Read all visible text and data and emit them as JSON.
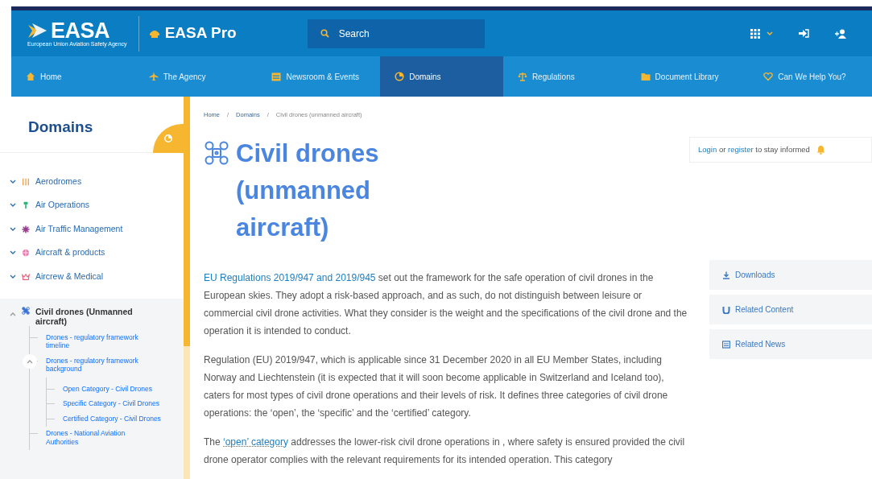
{
  "header": {
    "logo": "EASA",
    "logo_subtitle": "European Union Aviation Safety Agency",
    "product": "EASA Pro",
    "search": {
      "placeholder": "Search"
    }
  },
  "nav": [
    {
      "label": "Home",
      "selected": false
    },
    {
      "label": "The Agency",
      "selected": false
    },
    {
      "label": "Newsroom & Events",
      "selected": false
    },
    {
      "label": "Domains",
      "selected": true
    },
    {
      "label": "Regulations",
      "selected": false
    },
    {
      "label": "Document Library",
      "selected": false
    },
    {
      "label": "Can We Help You?",
      "selected": false
    }
  ],
  "sidebar": {
    "title": "Domains",
    "items": [
      {
        "label": "Aerodromes",
        "expanded": false,
        "selected": false,
        "color": "#f0a452"
      },
      {
        "label": "Air Operations",
        "expanded": false,
        "selected": false,
        "color": "#2fb67c"
      },
      {
        "label": "Air Traffic Management",
        "expanded": false,
        "selected": false,
        "color": "#9a3c8e"
      },
      {
        "label": "Aircraft & products",
        "expanded": false,
        "selected": false,
        "color": "#e77fb3"
      },
      {
        "label": "Aircrew & Medical",
        "expanded": false,
        "selected": false,
        "color": "#e8607c"
      },
      {
        "label": "Civil drones (Unmanned aircraft)",
        "expanded": true,
        "selected": true,
        "color": "#3a72d6",
        "children": [
          {
            "label": "Drones - regulatory framework timeline"
          },
          {
            "label": "Drones - regulatory framework background",
            "expanded": true,
            "children": [
              {
                "label": "Open Category - Civil Drones"
              },
              {
                "label": "Specific Category - Civil Drones"
              },
              {
                "label": "Certified Category - Civil Drones"
              }
            ]
          },
          {
            "label": "Drones - National Aviation Authorities"
          }
        ]
      }
    ]
  },
  "breadcrumb": {
    "separator": "/",
    "items": [
      "Home",
      "Domains",
      "Civil drones (unmanned aircraft)"
    ]
  },
  "page_title": "Civil drones (unmanned aircraft)",
  "paragraphs": [
    [
      {
        "kind": "link",
        "text": "EU Regulations 2019/947 and 2019/945"
      },
      {
        "kind": "text",
        "text": " set out the framework for the safe operation of civil drones in the European skies. They adopt a risk-based approach, and as such, do not distinguish between leisure or commercial civil drone activities. What they consider is the weight and the specifications of the civil drone and the operation it is intended to conduct."
      }
    ],
    [
      {
        "kind": "text",
        "text": "Regulation (EU) 2019/947, which is applicable since 31 December 2020 in all EU Member States, including Norway and Liechtenstein (it is expected that it will soon become applicable in Switzerland and Iceland too), caters for most types of civil drone operations and their levels of risk. It defines three categories of civil drone operations: the ‘open’, the ‘specific’ and the ‘certified’ category."
      }
    ],
    [
      {
        "kind": "text",
        "text": "The "
      },
      {
        "kind": "term",
        "text": "‘open’ category"
      },
      {
        "kind": "text",
        "text": " addresses the lower-risk civil drone operations in , where safety is ensured provided the civil drone operator complies with the relevant requirements for its intended operation. This category"
      }
    ]
  ],
  "subscribe": [
    {
      "kind": "link",
      "text": "Login"
    },
    {
      "kind": "text",
      "text": " or "
    },
    {
      "kind": "link",
      "text": "register"
    },
    {
      "kind": "text",
      "text": " to stay informed"
    }
  ],
  "side_tabs": [
    "Downloads",
    "Related Content",
    "Related News"
  ]
}
